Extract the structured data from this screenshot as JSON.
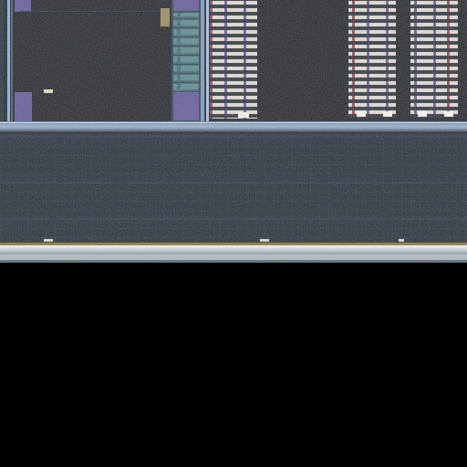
{
  "image": {
    "kind": "die-micrograph",
    "features": [
      "left-logic-block",
      "middle-interface-column",
      "left-memory-bank",
      "right-memory-bank-a",
      "right-memory-bank-b",
      "horizontal-metal-bus",
      "lower-routing-field",
      "bottom-edge-seal"
    ],
    "colors": {
      "background": "#000000",
      "die_base": "#151d26",
      "routing_field": "#18283a",
      "bus_light": "#9eb3cc",
      "memory_white": "#dcd5cf",
      "memory_purple": "#6b5d9e",
      "column_teal": "#4f7c86",
      "edge_seal": "#dfe6ea"
    }
  }
}
